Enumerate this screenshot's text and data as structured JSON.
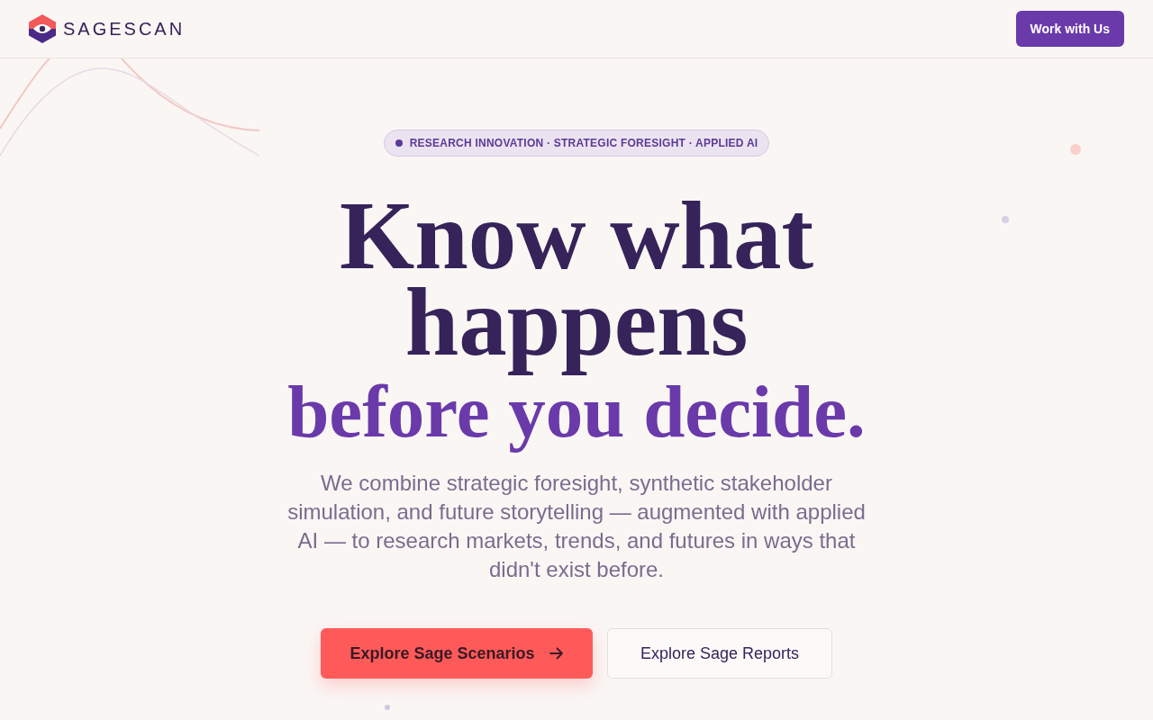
{
  "header": {
    "logo_text": "SAGESCAN",
    "cta_button": "Work with Us"
  },
  "hero": {
    "badge": "RESEARCH INNOVATION · STRATEGIC FORESIGHT · APPLIED AI",
    "headline": "Know what happens",
    "headline_accent": "before you decide.",
    "description": "We combine strategic foresight, synthetic stakeholder simulation, and future storytelling — augmented with applied AI — to research markets, trends, and futures in ways that didn't exist before.",
    "buttons": [
      {
        "label": "Explore Sage Scenarios",
        "kind": "primary"
      },
      {
        "label": "Explore Sage Reports",
        "kind": "secondary"
      }
    ]
  }
}
